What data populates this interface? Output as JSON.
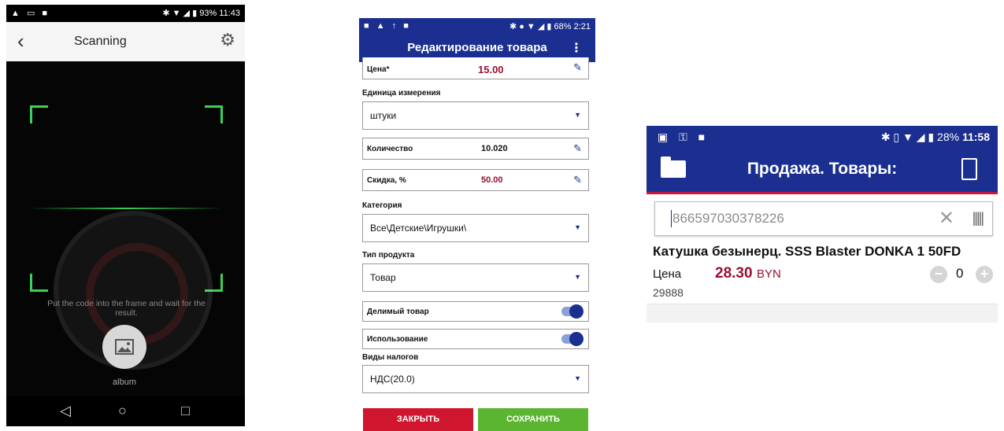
{
  "scanner": {
    "status_time": "11:43",
    "status_battery": "93%",
    "title": "Scanning",
    "hint": "Put the code into the frame and wait for the result.",
    "album_label": "album",
    "icons": [
      "back-icon",
      "gear-icon",
      "image-icon",
      "nav-back-icon",
      "nav-home-icon",
      "nav-recents-icon"
    ],
    "accent_color": "#3ad05a"
  },
  "editor": {
    "status_time": "2:21",
    "status_battery": "68%",
    "title": "Редактирование товара",
    "price_label": "Цена*",
    "price_value": "15.00",
    "unit_label": "Единица измерения",
    "unit_value": "штуки",
    "quantity_label": "Количество",
    "quantity_value": "10.020",
    "discount_label": "Скидка, %",
    "discount_value": "50.00",
    "category_label": "Категория",
    "category_value": "Все\\Детские\\Игрушки\\",
    "product_type_label": "Тип продукта",
    "product_type_value": "Товар",
    "divisible_label": "Делимый товар",
    "divisible_on": true,
    "usage_label": "Использование",
    "usage_on": true,
    "tax_label": "Виды налогов",
    "tax_value": "НДС(20.0)",
    "close_label": "ЗАКРЫТЬ",
    "save_label": "СОХРАНИТЬ",
    "colors": {
      "primary": "#1a2f8f",
      "close": "#d0162e",
      "save": "#5cb531",
      "accent_value": "#9a0f2e"
    }
  },
  "sale": {
    "status_time": "11:58",
    "status_battery": "28%",
    "title": "Продажа. Товары:",
    "search_value": "866597030378226",
    "item": {
      "name": "Катушка безынерц. SSS Blaster DONKA 1 50FD",
      "price_label": "Цена",
      "price": "28.30",
      "currency": "BYN",
      "code": "29888",
      "quantity": "0"
    },
    "colors": {
      "primary": "#1a2f8f",
      "underline": "#c2183a",
      "price": "#9a0f2e"
    }
  }
}
